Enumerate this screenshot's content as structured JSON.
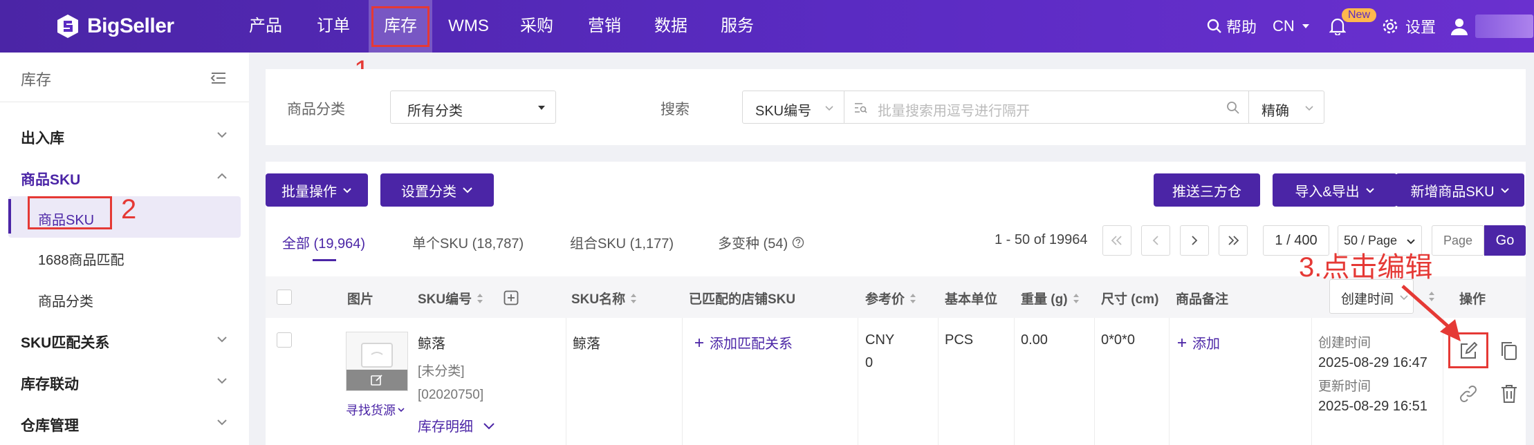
{
  "app": {
    "logo": "BigSeller"
  },
  "nav": [
    {
      "label": "产品"
    },
    {
      "label": "订单"
    },
    {
      "label": "库存"
    },
    {
      "label": "WMS"
    },
    {
      "label": "采购"
    },
    {
      "label": "营销"
    },
    {
      "label": "数据"
    },
    {
      "label": "服务"
    }
  ],
  "topbar": {
    "help": "帮助",
    "lang": "CN",
    "badge": "New",
    "settings": "设置"
  },
  "annotations": {
    "step1": "1",
    "step2": "2",
    "step3": "3.点击编辑",
    "color": "#e53935"
  },
  "sidebar": {
    "title": "库存",
    "items": [
      {
        "label": "出入库"
      },
      {
        "label": "商品SKU"
      },
      {
        "label": "商品SKU"
      },
      {
        "label": "1688商品匹配"
      },
      {
        "label": "商品分类"
      },
      {
        "label": "SKU匹配关系"
      },
      {
        "label": "库存联动"
      },
      {
        "label": "仓库管理"
      }
    ]
  },
  "filter": {
    "category_label": "商品分类",
    "category_value": "所有分类",
    "search_label": "搜索",
    "search_type": "SKU编号",
    "search_placeholder": "批量搜索用逗号进行隔开",
    "match_mode": "精确"
  },
  "toolbar": {
    "bulk": "批量操作",
    "set_category": "设置分类",
    "push_3pl": "推送三方仓",
    "import_export": "导入&导出",
    "add_sku": "新增商品SKU"
  },
  "tabs": [
    {
      "label": "全部 (19,964)"
    },
    {
      "label": "单个SKU (18,787)"
    },
    {
      "label": "组合SKU (1,177)"
    },
    {
      "label": "多变种 (54)"
    }
  ],
  "pagination": {
    "range": "1 - 50 of 19964",
    "page": "1 / 400",
    "page_size": "50 / Page",
    "goto_placeholder": "Page",
    "go": "Go"
  },
  "table": {
    "headers": {
      "image": "图片",
      "sku": "SKU编号",
      "name": "SKU名称",
      "matched": "已匹配的店铺SKU",
      "price": "参考价",
      "unit": "基本单位",
      "weight": "重量 (g)",
      "size": "尺寸 (cm)",
      "note": "商品备注",
      "sort": "创建时间",
      "ops": "操作"
    },
    "row": {
      "find_source": "寻找货源",
      "sku_title": "鲸落",
      "sku_category": "[未分类]",
      "sku_code": "[02020750]",
      "stock_detail": "库存明细",
      "name": "鲸落",
      "add_match": "添加匹配关系",
      "currency": "CNY",
      "price": "0",
      "unit": "PCS",
      "weight": "0.00",
      "size": "0*0*0",
      "add_note": "添加",
      "created_label": "创建时间",
      "created": "2025-08-29 16:47",
      "updated_label": "更新时间",
      "updated": "2025-08-29 16:51"
    }
  }
}
